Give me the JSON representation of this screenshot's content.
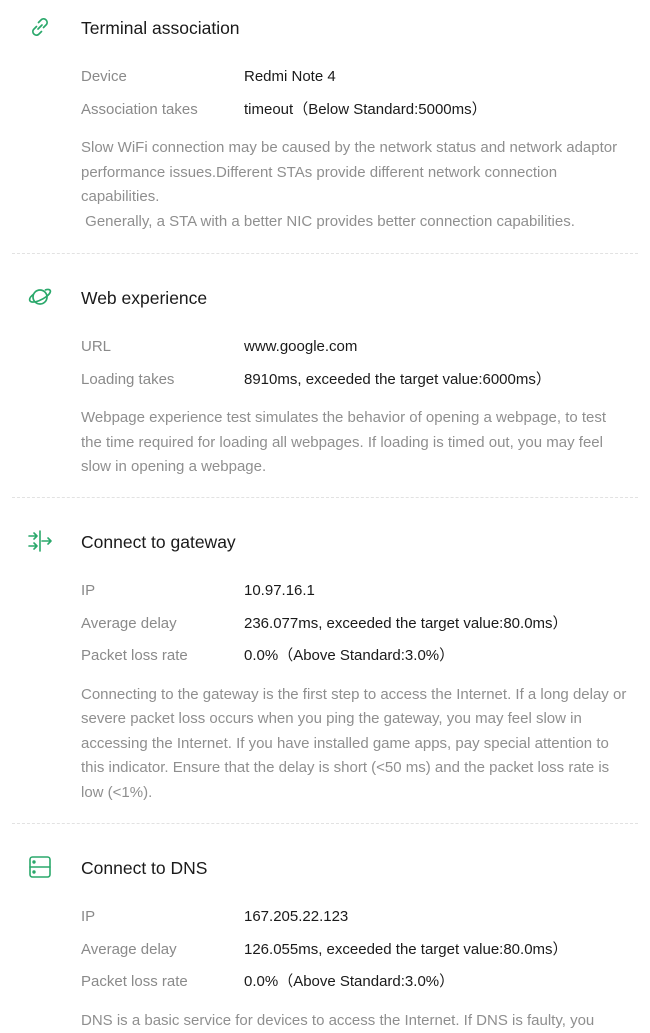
{
  "colors": {
    "accent": "#2aa86b",
    "label": "#8a8a8a",
    "desc": "#8f8f8f",
    "value": "#1a1a1a"
  },
  "sections": [
    {
      "icon": "link-icon",
      "title": "Terminal association",
      "rows": [
        {
          "label": "Device",
          "value": "Redmi Note 4"
        },
        {
          "label": "Association takes",
          "value": "timeout（Below Standard:5000ms）"
        }
      ],
      "description": "Slow WiFi connection may be caused by the network status and network adaptor performance issues.Different STAs provide different network connection capabilities.\n Generally, a STA with a better NIC provides better connection capabilities."
    },
    {
      "icon": "planet-icon",
      "title": "Web experience",
      "rows": [
        {
          "label": "URL",
          "value": "www.google.com"
        },
        {
          "label": "Loading takes",
          "value": "8910ms, exceeded the target value:6000ms）"
        }
      ],
      "description": "Webpage experience test simulates the behavior of opening a webpage, to test the time required for loading all webpages. If loading is timed out, you may feel slow in opening a webpage."
    },
    {
      "icon": "gateway-arrows-icon",
      "title": "Connect to gateway",
      "rows": [
        {
          "label": "IP",
          "value": "10.97.16.1"
        },
        {
          "label": "Average delay",
          "value": "236.077ms, exceeded the target value:80.0ms）"
        },
        {
          "label": "Packet loss rate",
          "value": "0.0%（Above Standard:3.0%）"
        }
      ],
      "description": "Connecting to the gateway is the first step to access the Internet. If a long delay or severe packet loss occurs when you ping the gateway, you may feel slow in accessing the Internet. If you have installed game apps, pay special attention to this indicator. Ensure that the delay is short (<50 ms) and the packet loss rate is low (<1%)."
    },
    {
      "icon": "server-icon",
      "title": "Connect to DNS",
      "rows": [
        {
          "label": "IP",
          "value": "167.205.22.123"
        },
        {
          "label": "Average delay",
          "value": "126.055ms, exceeded the target value:80.0ms）"
        },
        {
          "label": "Packet loss rate",
          "value": "0.0%（Above Standard:3.0%）"
        }
      ],
      "description": "DNS is a basic service for devices to access the Internet. If DNS is faulty, you"
    }
  ]
}
